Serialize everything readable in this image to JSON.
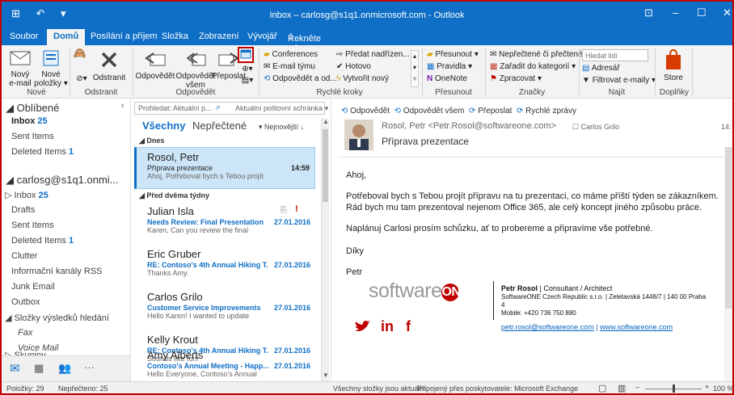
{
  "window": {
    "title": "Inbox – carlosg@s1q1.onmicrosoft.com - Outlook",
    "qat": "⊞ ↶ ▾",
    "min": "–",
    "max": "☐",
    "close": "✕",
    "ribbon_opts": "⊡"
  },
  "tabs": [
    "Soubor",
    "Domů",
    "Posílání a příjem",
    "Složka",
    "Zobrazení",
    "Vývojář"
  ],
  "tell_me": "Řekněte mi, co chcete udělat...",
  "ribbon": {
    "new_email": [
      "Nový",
      "e-mail"
    ],
    "new_items": [
      "Nové",
      "položky ▾"
    ],
    "delete": "Odstranit",
    "reply": "Odpovědět",
    "reply_all": [
      "Odpovědět",
      "všem"
    ],
    "forward": "Přeposlat",
    "quick_steps": [
      "Conferences",
      "E-mail týmu",
      "Odpovědět a od...",
      "Předat nadřízen...",
      "Hotovo",
      "Vytvořit nový"
    ],
    "move": "Přesunout ▾",
    "rules": "Pravidla ▾",
    "onenote": "OneNote",
    "unread_read": "Nepřečtené či přečtené",
    "categorize": "Zařadit do kategorií ▾",
    "followup": "Zpracovat ▾",
    "search_people_placeholder": "Hledat lidi",
    "address_book": "Adresář",
    "filter_email": "Filtrovat e-maily ▾",
    "store": "Store",
    "group_labels": [
      "Nové",
      "Odstranit",
      "Odpovědět",
      "Rychlé kroky",
      "Přesunout",
      "Značky",
      "Najít",
      "Doplňky"
    ]
  },
  "folders": {
    "favorites": "◢ Oblíbené",
    "fav_items": [
      {
        "label": "Inbox",
        "count": "25"
      },
      {
        "label": "Sent Items",
        "count": ""
      },
      {
        "label": "Deleted Items",
        "count": "1"
      }
    ],
    "account": "◢ carlosg@s1q1.onmi...",
    "items": [
      {
        "label": "▷ Inbox",
        "count": "25"
      },
      {
        "label": "Drafts",
        "count": ""
      },
      {
        "label": "Sent Items",
        "count": ""
      },
      {
        "label": "Deleted Items",
        "count": "1"
      },
      {
        "label": "Clutter",
        "count": ""
      },
      {
        "label": "Informační kanály RSS",
        "count": ""
      },
      {
        "label": "Junk Email",
        "count": ""
      },
      {
        "label": "Outbox",
        "count": ""
      },
      {
        "label": "◢ Složky výsledků hledání",
        "count": ""
      },
      {
        "label": "Fax",
        "count": ""
      },
      {
        "label": "Voice Mail",
        "count": ""
      },
      {
        "label": "▷ Skupiny",
        "count": ""
      }
    ]
  },
  "list": {
    "search_placeholder": "Prohledat: Aktuální p...",
    "scope": "Aktuální poštovní schránka",
    "filter_all": "Všechny",
    "filter_unread": "Nepřečtené",
    "sort": "Nejnovější ↓",
    "group_today": "◢ Dnes",
    "group_older": "◢ Před dvěma týdny",
    "messages": [
      {
        "from": "Rosol, Petr",
        "subject": "Příprava prezentace",
        "preview": "Ahoj, Potřeboval bych s Tebou projít",
        "date": "14:59"
      },
      {
        "from": "Julian Isla",
        "subject": "Needs Review: Final Presentation",
        "preview": "Karen, Can you review the final",
        "date": "27.01.2016"
      },
      {
        "from": "Eric Gruber",
        "subject": "RE: Contoso's 4th Annual Hiking T...",
        "preview": "Thanks Amy.",
        "date": "27.01.2016"
      },
      {
        "from": "Carlos Grilo",
        "subject": "Customer Service Improvements",
        "preview": "Hello Karen! I wanted to update",
        "date": "27.01.2016"
      },
      {
        "from": "Kelly Krout",
        "subject": "RE: Contoso's 4th Annual Hiking T...",
        "preview": "Sounds like fun!",
        "date": "27.01.2016"
      },
      {
        "from": "Amy Alberts",
        "subject": "Contoso's Annual Meeting - Happ...",
        "preview": "Hello Everyone, Contoso's Annual",
        "date": "27.01.2016"
      }
    ]
  },
  "reading": {
    "actions": [
      "Odpovědět",
      "Odpovědět všem",
      "Přeposlat",
      "Rychlé zprávy"
    ],
    "sender": "Rosol, Petr <Petr.Rosol@softwareone.com>",
    "to": "Carlos Grilo",
    "time": "14:",
    "subject": "Příprava prezentace",
    "body": [
      "Ahoj,",
      "Potřeboval bych s Tebou projít přípravu na tu prezentaci, co máme příští týden se zákazníkem.",
      "Rád bych mu tam prezentoval nejenom Office 365, ale celý koncept jiného způsobu práce.",
      "Naplánuj Carlosi prosím schůzku, ať to probereme a připravíme vše potřebné.",
      "Díky",
      "Petr"
    ],
    "sig_logo_a": "software",
    "sig_logo_b": "ONE",
    "sig_name": "Petr Rosol",
    "sig_title": " | Consultant / Architect",
    "sig_company": "SoftwareONE Czech Republic s.r.o. | Zeletavská 1448/7 | 140 00 Praha",
    "sig_company2": "4",
    "sig_mobile": "Mobile: +420 736 750 880",
    "sig_email": "petr.rosol@softwareone.com",
    "sig_sep": "|",
    "sig_web": "www.softwareone.com",
    "social": [
      "🐦",
      "in",
      "f"
    ]
  },
  "status": {
    "items": "Položky: 29",
    "unread": "Nepřečteno: 25",
    "sync": "Všechny složky jsou aktuální.",
    "connected": "Připojený přes poskytovatele: Microsoft Exchange",
    "zoom": "100 %"
  },
  "colors": {
    "accent": "#0f6fc6",
    "highlight_box": "#c00000"
  }
}
